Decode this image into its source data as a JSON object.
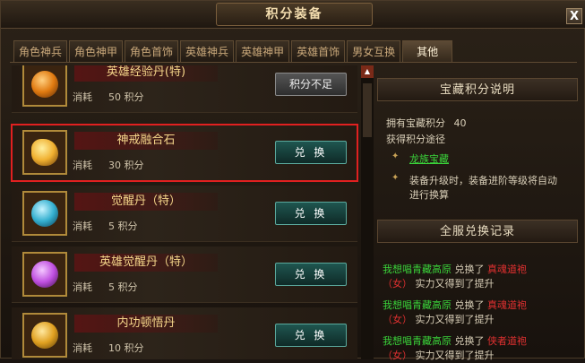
{
  "window": {
    "title": "积分装备",
    "close_label": "X"
  },
  "tabs": [
    "角色神兵",
    "角色神甲",
    "角色首饰",
    "英雄神兵",
    "英雄神甲",
    "英雄首饰",
    "男女互换",
    "其他"
  ],
  "items": [
    {
      "name": "英雄经验丹(特)",
      "cost_label": "消耗",
      "cost": "50 积分",
      "button": "积分不足",
      "disabled": true
    },
    {
      "name": "神戒融合石",
      "cost_label": "消耗",
      "cost": "30 积分",
      "button": "兑 换",
      "selected": true
    },
    {
      "name": "觉醒丹（特）",
      "cost_label": "消耗",
      "cost": "5 积分",
      "button": "兑 换"
    },
    {
      "name": "英雄觉醒丹（特）",
      "cost_label": "消耗",
      "cost": "5 积分",
      "button": "兑 换"
    },
    {
      "name": "内功顿悟丹",
      "cost_label": "消耗",
      "cost": "10 积分",
      "button": "兑 换"
    }
  ],
  "info_panel": {
    "title": "宝藏积分说明",
    "owned_label": "拥有宝藏积分",
    "owned_value": "40",
    "route_label": "获得积分途径",
    "link": "龙族宝藏",
    "desc_line1": "装备升级时，装备进阶等级将自动",
    "desc_line2": "进行换算"
  },
  "records_panel": {
    "title": "全服兑换记录",
    "records": [
      {
        "player": "我想唱青藏高原",
        "action": "兑换了",
        "item": "真魂道袍",
        "suffix": "（女）",
        "note": "实力又得到了提升"
      },
      {
        "player": "我想唱青藏高原",
        "action": "兑换了",
        "item": "真魂道袍",
        "suffix": "（女）",
        "note": "实力又得到了提升"
      },
      {
        "player": "我想唱青藏高原",
        "action": "兑换了",
        "item": "侠者道袍",
        "suffix": "（女）",
        "note": "实力又得到了提升"
      }
    ]
  },
  "colors": {
    "accent_green": "#3ad43a",
    "accent_red": "#e03030",
    "highlight": "#e02020",
    "button_teal": "#1f5650"
  },
  "orbs": [
    "#e07a10",
    "#f0b030",
    "#35b0d0",
    "#c050e0",
    "#e0a020"
  ]
}
